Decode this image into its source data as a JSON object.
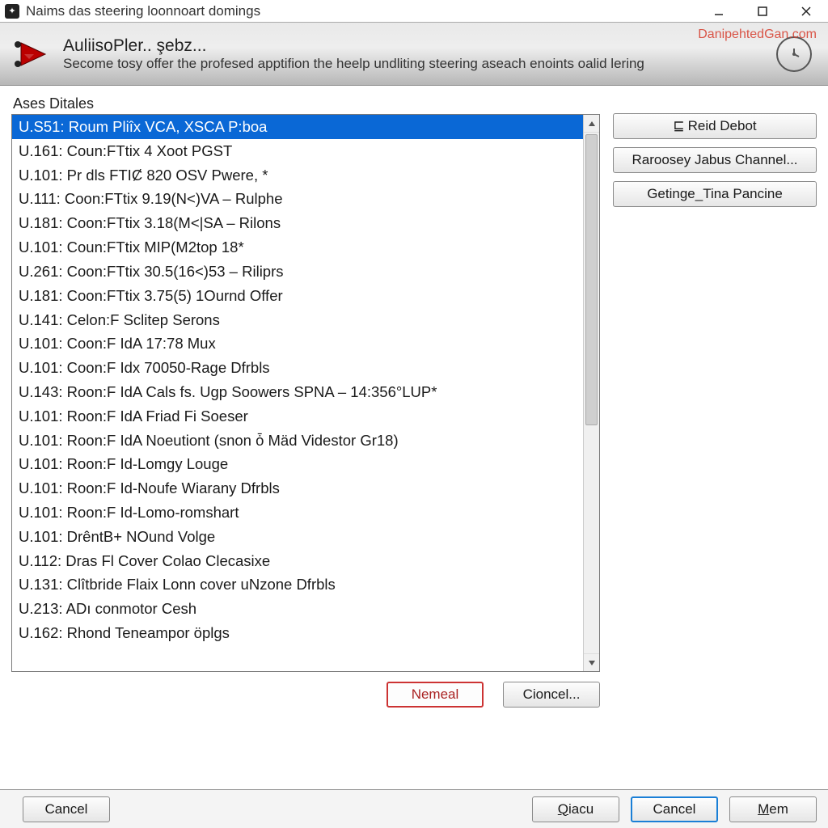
{
  "window": {
    "title": "Naims das steering loonnoart domings"
  },
  "banner": {
    "title": "AuliisoPler.. şebz...",
    "subtitle": "Secome tosy offer the profesed apptifion the heelp undliting steering aseach enoints oalid lering",
    "watermark": "DanipehtedGan.com"
  },
  "panel": {
    "label": "Ases Ditales"
  },
  "list": {
    "items": [
      "U.S51: Roum Pliîx VCA, XSCA P:boa",
      "U.161: Coun:FTtix 4 Xoot PGST",
      "U.101: Pr dls FTIȻ 820 OSV Pwere, *",
      "U.111: Coon:FTtix 9.19(N<)VA – Rulphe",
      "U.181: Coon:FTtix 3.18(M<|SA – Rilons",
      "U.101: Coun:FTtix MIP(M2top 18*",
      "U.261: Coon:FTtix 30.5(16<)53 – Riliprs",
      "U.181: Coon:FTtix 3.75(5) 1Ournd Offer",
      "U.141: Celon:F Sclitep Serons",
      "U.101: Coon:F IdA 17:78  Mux",
      "U.101: Coon:F Idx 70050-Rage Dfrbls",
      "U.143: Roon:F IdA Cals fs. Ugp Soowers SPNA – 14:356°LUP*",
      "U.101: Roon:F IdA Friad Fi Soeser",
      "U.101: Roon:F IdA Noeutiont (snon ȱ Mäd Videstor Gr18)",
      "U.101: Roon:F Id-Lomgy Louge",
      "U.101: Roon:F Id-Noufe Wiarany Dfrbls",
      "U.101: Roon:F Id-Lomo-romshart",
      "U.101: DrêntB+ NOund Volge",
      "U.112: Dras Fl Cover Colao Clecasixe",
      "U.131: Clîtbride Flaix Lonn cover uNzone Dfrbls",
      "U.213: ADı conmotor Cesh",
      "U.162: Rhond Teneampor öplgs"
    ],
    "selectedIndex": 0
  },
  "sideButtons": {
    "reidDebot": "Reid Debot",
    "rarooseyJabus": "Raroosey Jabus Channel...",
    "getingeTina": "Getinge_Tina Pancine"
  },
  "belowButtons": {
    "nemeal": "Nemeal",
    "cioncel": "Cioncel..."
  },
  "bottomButtons": {
    "cancelLeft": "Cancel",
    "oiacu": "Qiacu",
    "cancelRight": "Cancel",
    "mem": "Mem"
  }
}
